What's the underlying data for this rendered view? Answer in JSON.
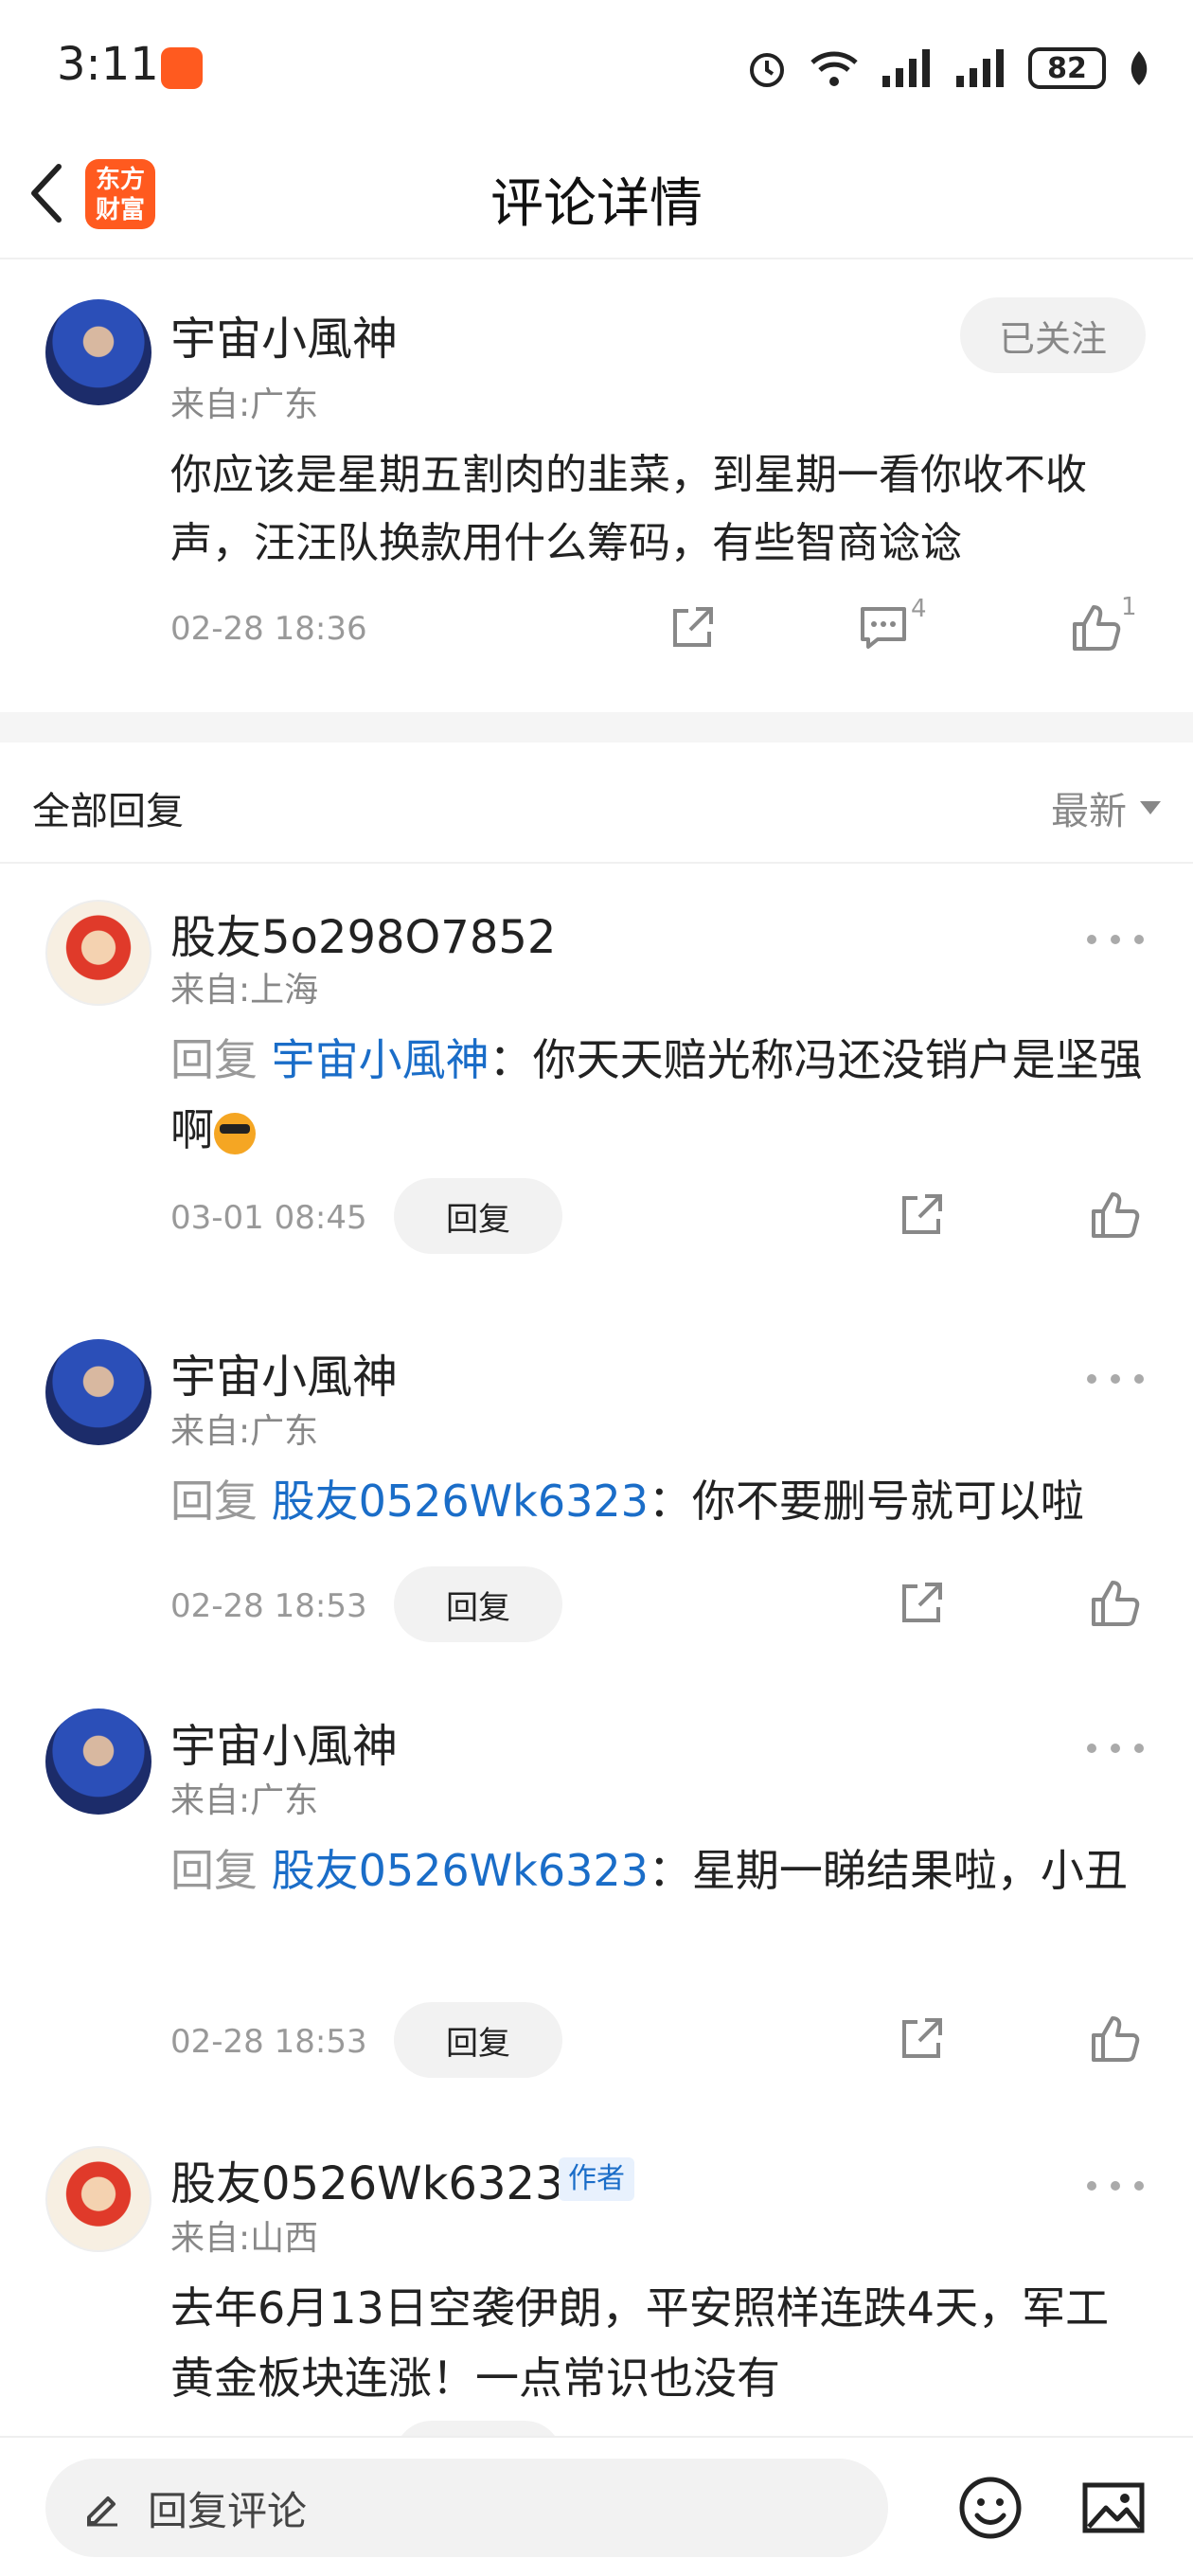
{
  "status_bar": {
    "time": "3:11",
    "battery": "82"
  },
  "header": {
    "title": "评论详情",
    "logo_line1": "东方",
    "logo_line2": "财富"
  },
  "main_comment": {
    "author": "宇宙小風神",
    "region": "来自:广东",
    "follow_label": "已关注",
    "text": "你应该是星期五割肉的韭菜，到星期一看你收不收声，汪汪队换款用什么筹码，有些智商谂谂",
    "time": "02-28 18:36",
    "comment_count": "4",
    "like_count": "1"
  },
  "replies_header": {
    "title": "全部回复",
    "sort_label": "最新"
  },
  "replies": [
    {
      "author": "股友5o298O7852",
      "region": "来自:上海",
      "reply_prefix": "回复",
      "mention": "宇宙小風神",
      "text": "：你天天赔光称冯还没销户是坚强啊",
      "time": "03-01 08:45",
      "reply_label": "回复"
    },
    {
      "author": "宇宙小風神",
      "region": "来自:广东",
      "reply_prefix": "回复",
      "mention": "股友0526Wk6323",
      "text": "：你不要删号就可以啦",
      "time": "02-28 18:53",
      "reply_label": "回复"
    },
    {
      "author": "宇宙小風神",
      "region": "来自:广东",
      "reply_prefix": "回复",
      "mention": "股友0526Wk6323",
      "text": "：星期一睇结果啦，小丑",
      "time": "02-28 18:53",
      "reply_label": "回复"
    },
    {
      "author": "股友0526Wk6323",
      "author_tag": "作者",
      "region": "来自:山西",
      "text": "去年6月13日空袭伊朗，平安照样连跌4天，军工黄金板块连涨！一点常识也没有"
    }
  ],
  "bottom_bar": {
    "placeholder": "回复评论"
  }
}
